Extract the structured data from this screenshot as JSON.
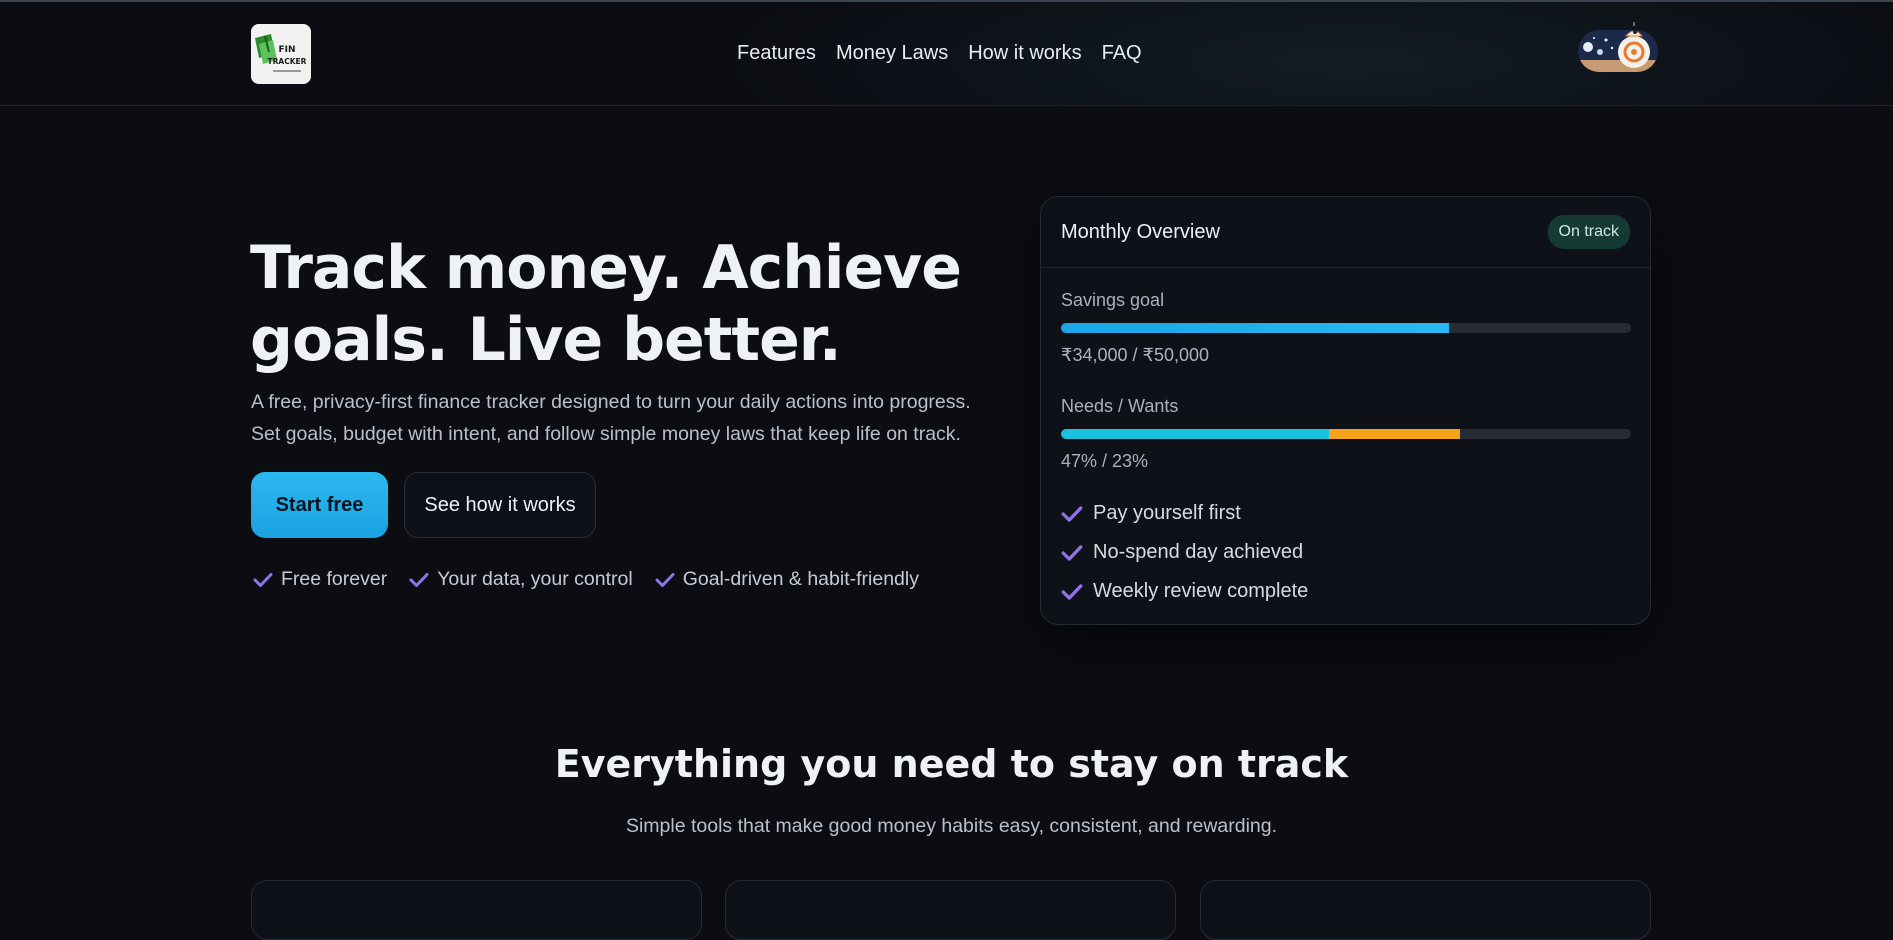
{
  "brand": {
    "logo_text_top": "FIN",
    "logo_text_bottom": "TRACKER",
    "logo_icon": "money-stack-logo"
  },
  "nav": {
    "links": [
      "Features",
      "Money Laws",
      "How it works",
      "FAQ"
    ],
    "avatar_icon": "robot-droid-avatar"
  },
  "hero": {
    "title_line1": "Track money. Achieve",
    "title_line2": "goals. Live better.",
    "subtitle_line1": "A free, privacy-first finance tracker designed to turn your daily actions into progress.",
    "subtitle_line2": "Set goals, budget with intent, and follow simple money laws that keep life on track.",
    "primary_cta": "Start free",
    "secondary_cta": "See how it works",
    "checks": [
      "Free forever",
      "Your data, your control",
      "Goal-driven & habit-friendly"
    ]
  },
  "overview_card": {
    "title": "Monthly Overview",
    "badge": "On track",
    "savings": {
      "label": "Savings goal",
      "value_text": "₹34,000 / ₹50,000",
      "progress": 0.68
    },
    "needs_wants": {
      "label": "Needs / Wants",
      "value_text": "47% / 23%",
      "needs_fraction": 0.47,
      "wants_fraction": 0.23
    },
    "checklist": [
      "Pay yourself first",
      "No-spend day achieved",
      "Weekly review complete"
    ]
  },
  "features_section": {
    "title": "Everything you need to stay on track",
    "subtitle": "Simple tools that make good money habits easy, consistent, and rewarding."
  },
  "colors": {
    "background": "#0b0d12",
    "accent_blue": "#22b0ef",
    "accent_cyan": "#19c0e0",
    "accent_amber": "#f5a21b",
    "check_purple": "#8f73e8",
    "badge_green": "#143a33"
  }
}
